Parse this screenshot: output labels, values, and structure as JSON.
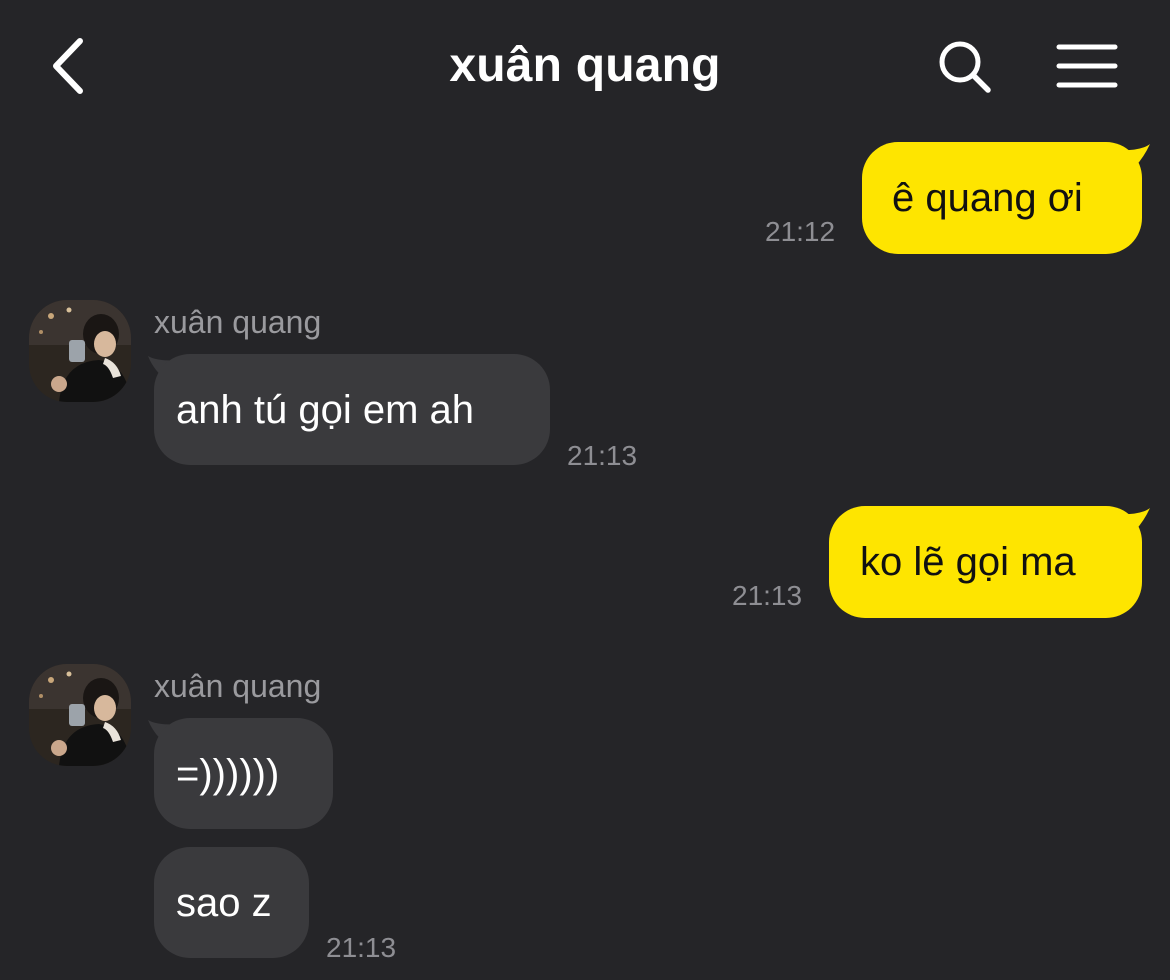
{
  "header": {
    "title": "xuân quang",
    "back_icon": "chevron-left-icon",
    "search_icon": "search-icon",
    "menu_icon": "hamburger-menu-icon"
  },
  "colors": {
    "background": "#252528",
    "outgoing_bubble": "#fee500",
    "incoming_bubble": "#3a3a3d",
    "timestamp": "#8e8e93",
    "sender_name": "#9a9a9e"
  },
  "messages": [
    {
      "direction": "outgoing",
      "text": "ê quang ơi",
      "time": "21:12"
    },
    {
      "direction": "incoming",
      "sender": "xuân quang",
      "text": "anh tú gọi em ah",
      "time": "21:13"
    },
    {
      "direction": "outgoing",
      "text": "ko lẽ gọi ma",
      "time": "21:13"
    },
    {
      "direction": "incoming",
      "sender": "xuân quang",
      "text": "=))))))",
      "time": ""
    },
    {
      "direction": "incoming",
      "text": "sao z",
      "time": "21:13"
    }
  ]
}
